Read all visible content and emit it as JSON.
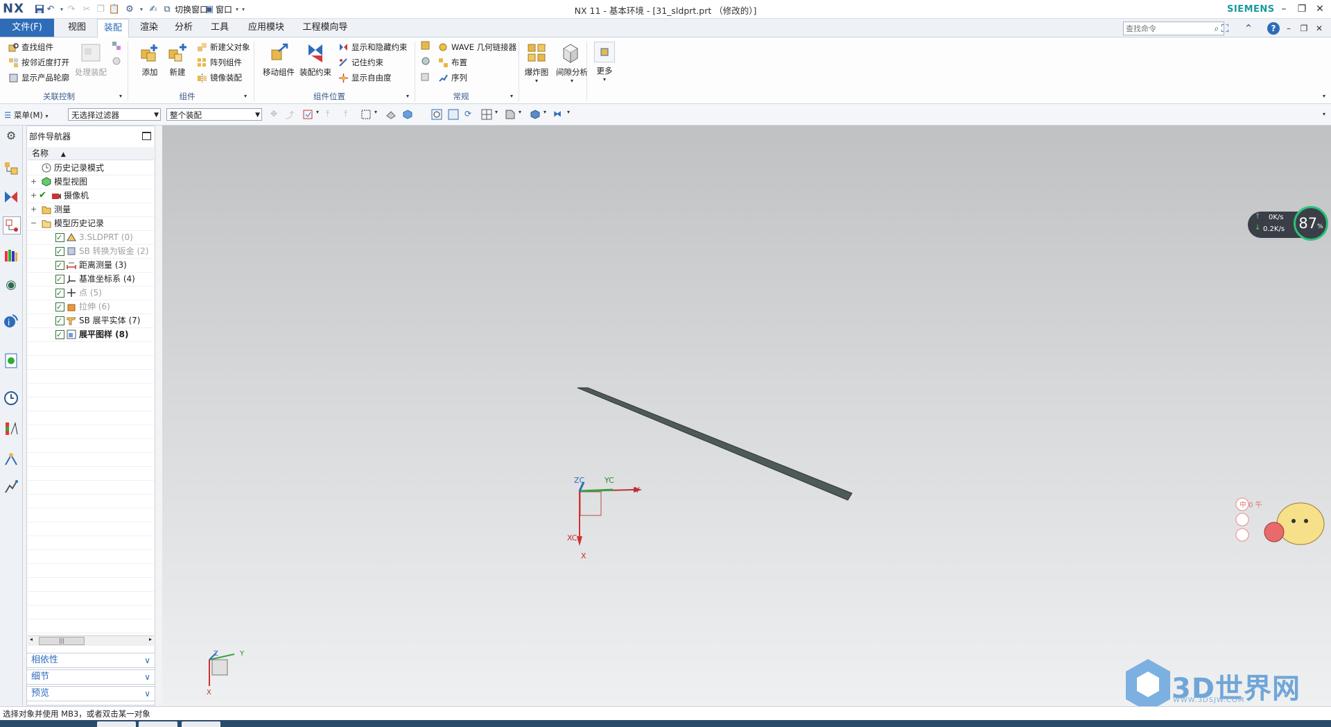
{
  "app": {
    "logo": "NX",
    "window_title": "NX 11 - 基本环境 - [31_sldprt.prt （修改的）]",
    "brand": "SIEMENS",
    "quick_access": {
      "switch_window": "切换窗口",
      "window": "窗口"
    }
  },
  "menu": {
    "file": "文件(F)",
    "tabs": [
      "视图",
      "装配",
      "渲染",
      "分析",
      "工具",
      "应用模块",
      "工程模向导"
    ],
    "active_tab": "装配",
    "search_placeholder": "查找命令"
  },
  "ribbon": {
    "assoc_control": {
      "find_component": "查找组件",
      "open_by_proximity": "按邻近度打开",
      "show_product_outline": "显示产品轮廓",
      "process_assembly": "处理装配",
      "label": "关联控制"
    },
    "component": {
      "add": "添加",
      "new": "新建",
      "new_parent": "新建父对象",
      "array": "阵列组件",
      "mirror": "镜像装配",
      "label": "组件"
    },
    "position": {
      "move": "移动组件",
      "constraint": "装配约束",
      "show_hide_constraint": "显示和隐藏约束",
      "remember_constraint": "记住约束",
      "show_dof": "显示自由度",
      "label": "组件位置"
    },
    "general": {
      "wave": "WAVE 几何链接器",
      "layout": "布置",
      "sequence": "序列",
      "label": "常规"
    },
    "exploded": "爆炸图",
    "clearance": "间隙分析",
    "more": "更多"
  },
  "toolbar2": {
    "menu": "菜单(M)",
    "selection_filter": "无选择过滤器",
    "scope": "整个装配"
  },
  "navigator": {
    "title": "部件导航器",
    "column": "名称",
    "items": [
      {
        "label": "历史记录模式"
      },
      {
        "label": "模型视图"
      },
      {
        "label": "摄像机"
      },
      {
        "label": "测量"
      },
      {
        "label": "模型历史记录"
      }
    ],
    "history": [
      {
        "label": "3.SLDPRT (0)"
      },
      {
        "label": "SB 转换为钣金 (2)"
      },
      {
        "label": "距离测量 (3)"
      },
      {
        "label": "基准坐标系 (4)"
      },
      {
        "label": "点 (5)"
      },
      {
        "label": "拉伸 (6)"
      },
      {
        "label": "SB 展平实体 (7)"
      },
      {
        "label": "展平图样 (8)"
      }
    ],
    "panels": [
      "相依性",
      "细节",
      "预览"
    ]
  },
  "viewport": {
    "csys_labels": {
      "zc": "ZC",
      "yc": "YC",
      "y": "Y",
      "xc": "XC",
      "x": "X"
    },
    "triad_labels": {
      "z": "Z",
      "y": "Y",
      "x": "X"
    }
  },
  "speed_widget": {
    "percent": "87",
    "percent_unit": "%",
    "up": "0K/s",
    "down": "0.2K/s"
  },
  "watermark": {
    "text": "3D世界网",
    "url": "WWW.3DSJW.COM",
    "mascot_text": "中 0 午"
  },
  "status": {
    "message": "选择对象并使用 MB3，或者双击某一对象"
  },
  "colors": {
    "accent": "#2e6cb8",
    "brand": "#179aa0",
    "watermark": "#6fa6d8",
    "part": "#4e5a58"
  }
}
